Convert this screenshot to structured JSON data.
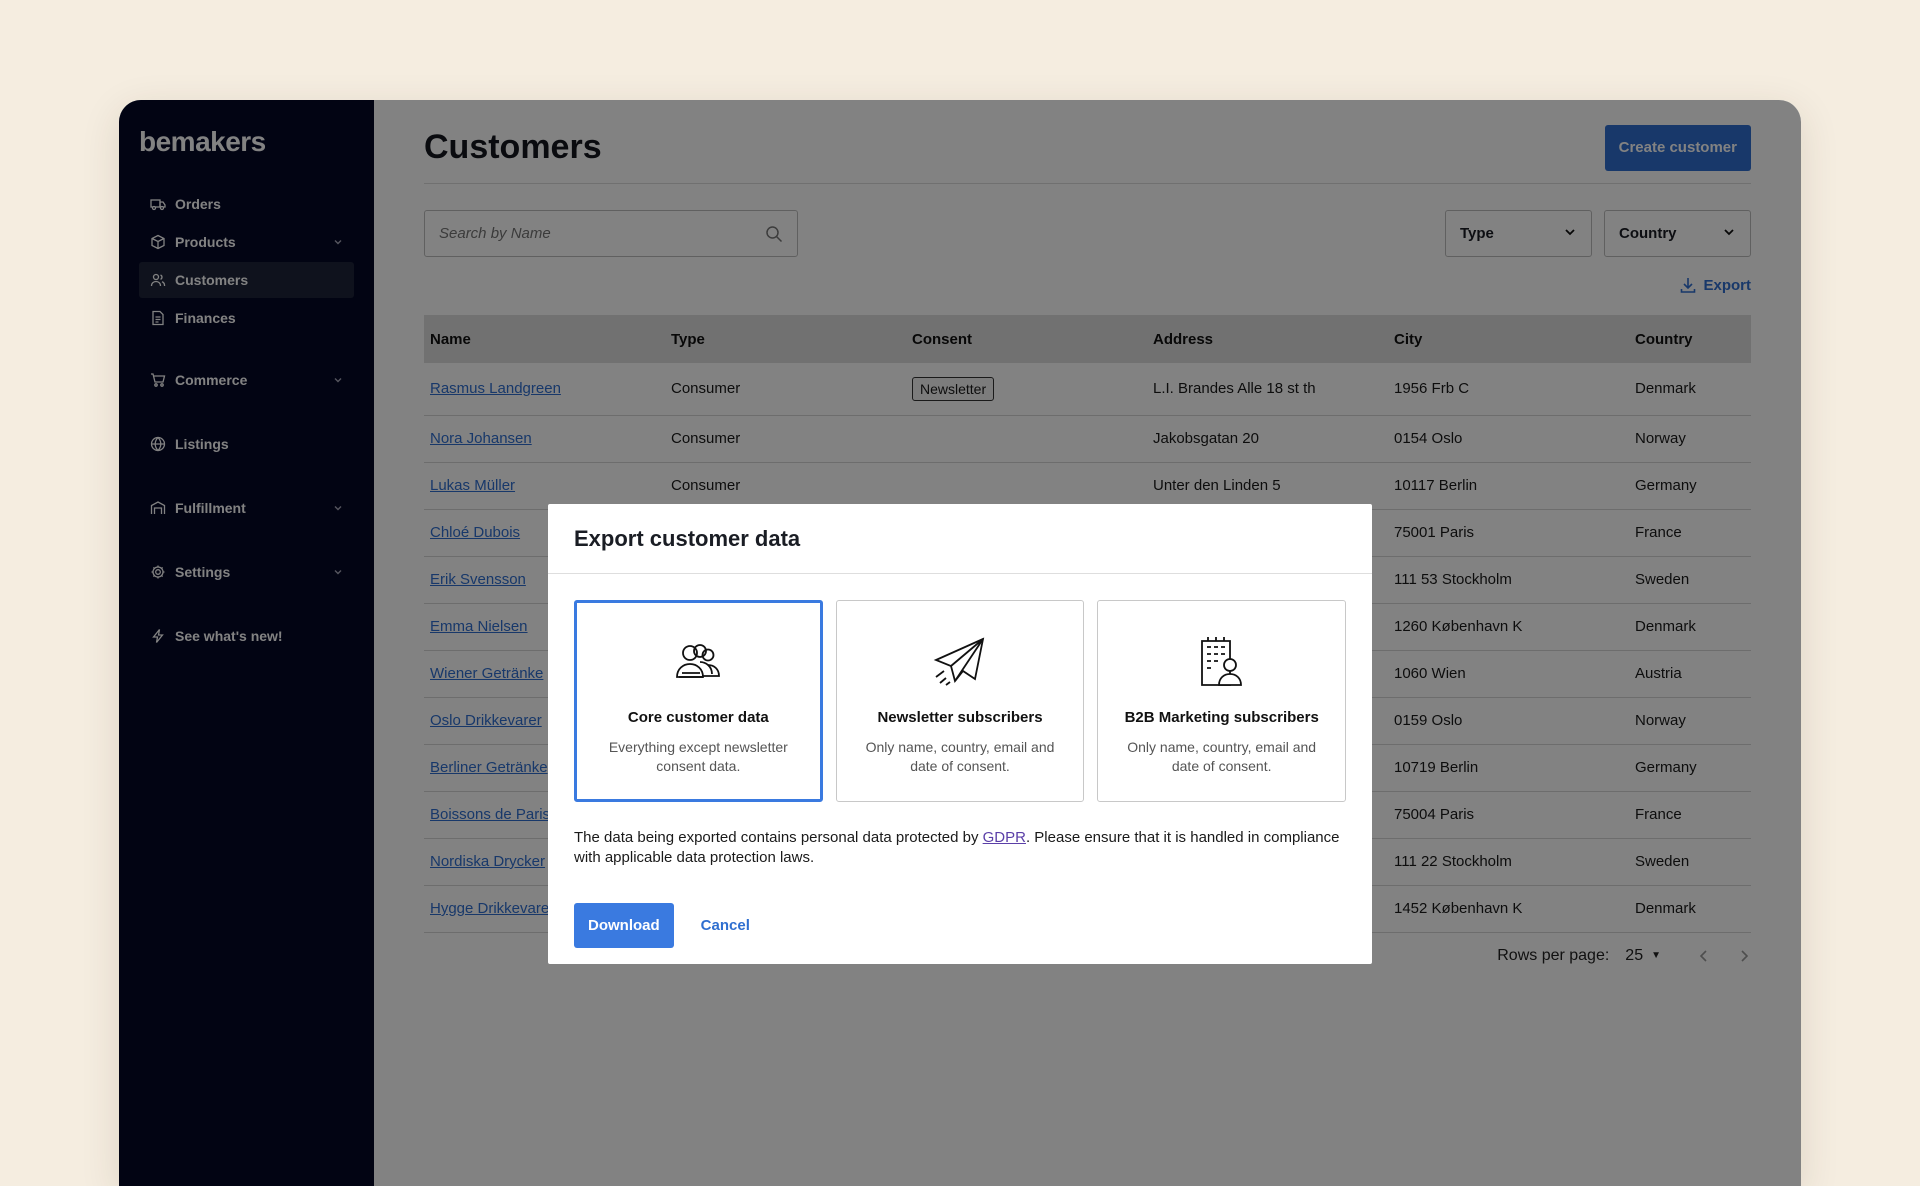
{
  "app": {
    "logo": "bemakers"
  },
  "sidebar": {
    "items": [
      {
        "label": "Orders",
        "icon": "truck-icon"
      },
      {
        "label": "Products",
        "icon": "box-icon",
        "expandable": true
      },
      {
        "label": "Customers",
        "icon": "users-icon",
        "active": true
      },
      {
        "label": "Finances",
        "icon": "document-icon"
      },
      {
        "label": "Commerce",
        "icon": "cart-icon",
        "expandable": true
      },
      {
        "label": "Listings",
        "icon": "globe-icon"
      },
      {
        "label": "Fulfillment",
        "icon": "warehouse-icon",
        "expandable": true
      },
      {
        "label": "Settings",
        "icon": "gear-icon",
        "expandable": true
      },
      {
        "label": "See what's new!",
        "icon": "bolt-icon"
      }
    ]
  },
  "header": {
    "title": "Customers",
    "create_label": "Create customer"
  },
  "filters": {
    "search_placeholder": "Search by Name",
    "type_label": "Type",
    "country_label": "Country",
    "export_label": "Export"
  },
  "table": {
    "columns": [
      "Name",
      "Type",
      "Consent",
      "Address",
      "City",
      "Country"
    ],
    "rows": [
      {
        "name": "Rasmus Landgreen",
        "type": "Consumer",
        "consent": "Newsletter",
        "address": "L.I. Brandes Alle 18 st th",
        "city": "1956 Frb C",
        "country": "Denmark"
      },
      {
        "name": "Nora Johansen",
        "type": "Consumer",
        "consent": "",
        "address": "Jakobsgatan 20",
        "city": "0154 Oslo",
        "country": "Norway"
      },
      {
        "name": "Lukas Müller",
        "type": "Consumer",
        "consent": "",
        "address": "Unter den Linden 5",
        "city": "10117 Berlin",
        "country": "Germany"
      },
      {
        "name": "Chloé Dubois",
        "type": "",
        "consent": "",
        "address": "",
        "city": "75001 Paris",
        "country": "France"
      },
      {
        "name": "Erik Svensson",
        "type": "",
        "consent": "",
        "address": "",
        "city": "111 53 Stockholm",
        "country": "Sweden"
      },
      {
        "name": "Emma Nielsen",
        "type": "",
        "consent": "",
        "address": "",
        "city": "1260 København K",
        "country": "Denmark"
      },
      {
        "name": "Wiener Getränke",
        "type": "",
        "consent": "",
        "address": "",
        "city": "1060 Wien",
        "country": "Austria"
      },
      {
        "name": "Oslo Drikkevarer",
        "type": "",
        "consent": "",
        "address": "",
        "city": "0159 Oslo",
        "country": "Norway"
      },
      {
        "name": "Berliner Getränke",
        "type": "",
        "consent": "",
        "address": "",
        "city": "10719 Berlin",
        "country": "Germany"
      },
      {
        "name": "Boissons de Paris",
        "type": "",
        "consent": "",
        "address": "",
        "city": "75004 Paris",
        "country": "France"
      },
      {
        "name": "Nordiska Drycker",
        "type": "",
        "consent": "",
        "address": "",
        "city": "111 22 Stockholm",
        "country": "Sweden"
      },
      {
        "name": "Hygge Drikkevarer",
        "type": "",
        "consent": "",
        "address": "",
        "city": "1452 København K",
        "country": "Denmark"
      }
    ]
  },
  "pagination": {
    "rows_per_page_label": "Rows per page:",
    "rows_per_page_value": "25"
  },
  "modal": {
    "title": "Export customer data",
    "options": [
      {
        "title": "Core customer data",
        "description": "Everything except newsletter consent data.",
        "icon": "users-group-icon",
        "selected": true
      },
      {
        "title": "Newsletter subscribers",
        "description": "Only name, country, email and date of consent.",
        "icon": "paper-plane-icon",
        "selected": false
      },
      {
        "title": "B2B Marketing subscribers",
        "description": "Only name, country, email and date of consent.",
        "icon": "office-person-icon",
        "selected": false
      }
    ],
    "notice_before": "The data being exported contains personal data protected by ",
    "notice_link": "GDPR",
    "notice_after": ". Please ensure that it is handled in compliance with applicable data protection laws.",
    "download_label": "Download",
    "cancel_label": "Cancel"
  },
  "colors": {
    "sidebar_bg": "#040826",
    "accent": "#2f6fd0",
    "page_bg": "#f5ede0"
  }
}
